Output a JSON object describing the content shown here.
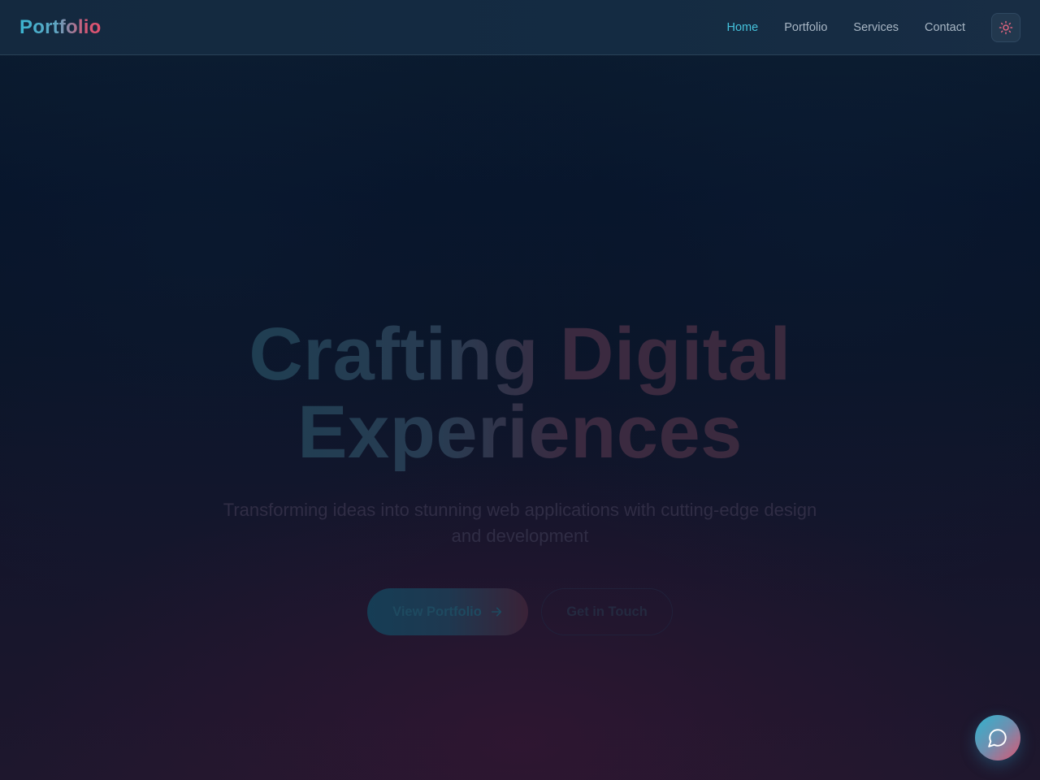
{
  "header": {
    "logo": "Portfolio",
    "nav": [
      {
        "label": "Home",
        "active": true
      },
      {
        "label": "Portfolio",
        "active": false
      },
      {
        "label": "Services",
        "active": false
      },
      {
        "label": "Contact",
        "active": false
      }
    ],
    "theme_toggle_icon": "sun-icon"
  },
  "hero": {
    "title_line1": "Crafting Digital",
    "title_line2": "Experiences",
    "subtitle": "Transforming ideas into stunning web applications with cutting-edge design and development",
    "primary_button": "View Portfolio",
    "primary_button_icon": "arrow-right-icon",
    "secondary_button": "Get in Touch"
  },
  "chat": {
    "icon": "chat-bubble-icon"
  },
  "colors": {
    "accent_cyan": "#45c3dc",
    "accent_pink": "#e0506e",
    "background_top": "#0b1c2f",
    "background_bottom": "#1e172d"
  }
}
